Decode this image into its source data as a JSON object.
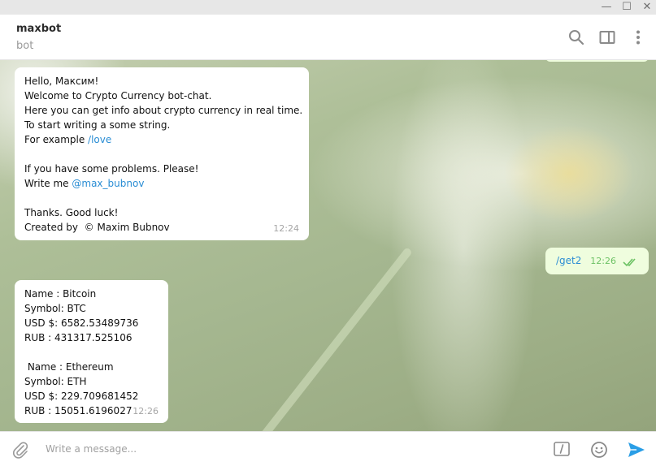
{
  "window": {
    "minimize": "—",
    "maximize": "☐",
    "close": "✕"
  },
  "header": {
    "name": "maxbot",
    "status": "bot"
  },
  "messages": [
    {
      "lines": [
        {
          "text": "Hello, Максим!"
        },
        {
          "text": "Welcome to Crypto Currency bot-chat."
        },
        {
          "text": "Here you can get info about crypto currency in real time."
        },
        {
          "text": "To start writing a some string."
        },
        {
          "text": "For example ",
          "link": "/love"
        },
        {
          "text": ""
        },
        {
          "text": "If you have some problems. Please!"
        },
        {
          "text": "Write me ",
          "link": "@max_bubnov"
        },
        {
          "text": ""
        },
        {
          "text": "Thanks. Good luck!"
        },
        {
          "text": "Created by  © Maxim Bubnov"
        }
      ],
      "time": "12:24"
    },
    {
      "command": "/get2",
      "time": "12:26"
    },
    {
      "lines": [
        {
          "text": "Name : Bitcoin"
        },
        {
          "text": "Symbol: BTC"
        },
        {
          "text": "USD $: 6582.53489736"
        },
        {
          "text": "RUB : 431317.525106"
        },
        {
          "text": ""
        },
        {
          "text": " Name : Ethereum"
        },
        {
          "text": "Symbol: ETH"
        },
        {
          "text": "USD $: 229.709681452"
        },
        {
          "text": "RUB : 15051.6196027"
        }
      ],
      "time": "12:26"
    }
  ],
  "composer": {
    "placeholder": "Write a message..."
  },
  "colors": {
    "accent": "#2a8dd4",
    "outgoing_bubble": "#effdde",
    "read_check": "#6cc264"
  },
  "icons": {
    "header": [
      "search-icon",
      "side-panel-icon",
      "more-vertical-icon"
    ],
    "composer": [
      "paperclip-icon",
      "bot-command-icon",
      "emoji-icon",
      "send-icon"
    ],
    "status": "double-check-icon"
  }
}
